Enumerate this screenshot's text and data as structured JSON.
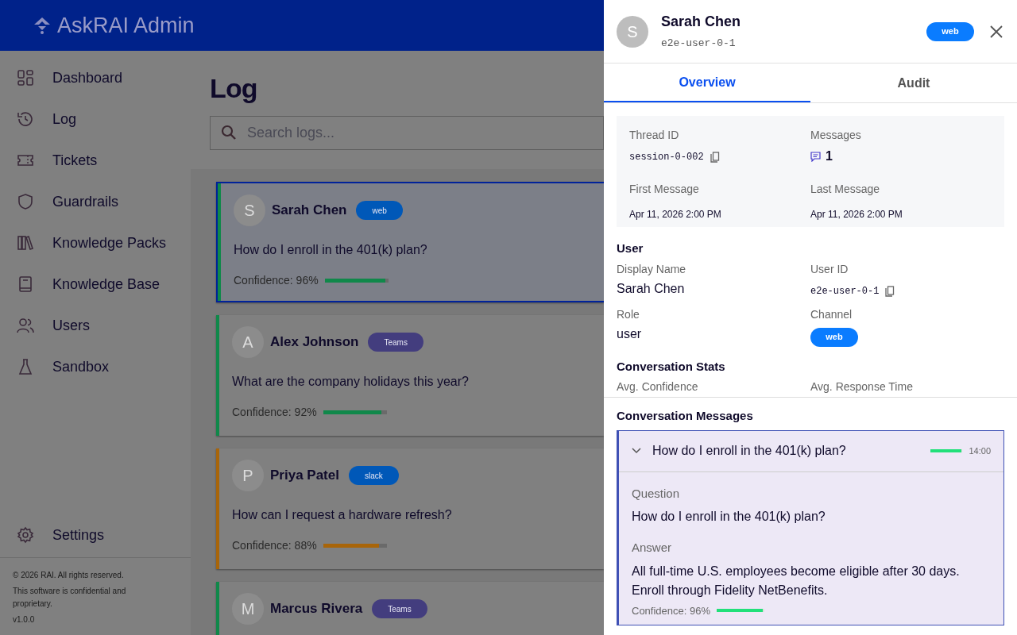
{
  "header": {
    "title": "AskRAI Admin"
  },
  "sidebar": {
    "items": [
      {
        "label": "Dashboard"
      },
      {
        "label": "Log"
      },
      {
        "label": "Tickets"
      },
      {
        "label": "Guardrails"
      },
      {
        "label": "Knowledge Packs"
      },
      {
        "label": "Knowledge Base"
      },
      {
        "label": "Users"
      },
      {
        "label": "Sandbox"
      }
    ],
    "settings": "Settings",
    "footer": [
      "© 2026 RAI. All rights reserved.",
      "This software is confidential and proprietary.",
      "v1.0.0"
    ]
  },
  "page": {
    "title": "Log",
    "search": {
      "placeholder": "Search logs..."
    }
  },
  "logs": [
    {
      "initial": "S",
      "name": "Sarah Chen",
      "channel": {
        "label": "web",
        "color": "#0058b8"
      },
      "question": "How do I enroll in the 401(k) plan?",
      "confidence": "Confidence: 96%",
      "level": 0.96,
      "color": "#10884a",
      "selected": true
    },
    {
      "initial": "A",
      "name": "Alex Johnson",
      "channel": {
        "label": "Teams",
        "color": "#433d7e"
      },
      "question": "What are the company holidays this year?",
      "confidence": "Confidence: 92%",
      "level": 0.92,
      "color": "#10884a",
      "selected": false
    },
    {
      "initial": "P",
      "name": "Priya Patel",
      "channel": {
        "label": "slack",
        "color": "#0058b8"
      },
      "question": "How can I request a hardware refresh?",
      "confidence": "Confidence: 88%",
      "level": 0.88,
      "color": "#a8650a",
      "selected": false
    },
    {
      "initial": "M",
      "name": "Marcus Rivera",
      "channel": {
        "label": "Teams",
        "color": "#433d7e"
      },
      "color": "#10884a",
      "selected": false
    }
  ],
  "panel": {
    "initial": "S",
    "name": "Sarah Chen",
    "user_id": "e2e-user-0-1",
    "channel": "web",
    "tabs": [
      {
        "label": "Overview",
        "selected": true
      },
      {
        "label": "Audit",
        "selected": false
      }
    ],
    "thread": [
      {
        "label": "Thread ID",
        "value": "session-0-002",
        "kind": "code"
      },
      {
        "label": "Messages",
        "value": "1",
        "kind": "count"
      },
      {
        "label": "First Message",
        "value": "Apr 11, 2026 2:00 PM",
        "kind": "date"
      },
      {
        "label": "Last Message",
        "value": "Apr 11, 2026 2:00 PM",
        "kind": "date"
      }
    ],
    "user_title": "User",
    "user": [
      {
        "label": "Display Name",
        "value": "Sarah Chen",
        "kind": "text"
      },
      {
        "label": "User ID",
        "value": "e2e-user-0-1",
        "kind": "code"
      },
      {
        "label": "Role",
        "value": "user",
        "kind": "text"
      },
      {
        "label": "Channel",
        "value": "web",
        "kind": "badge"
      }
    ],
    "stats_title": "Conversation Stats",
    "stats": [
      {
        "label": "Avg. Confidence"
      },
      {
        "label": "Avg. Response Time"
      }
    ],
    "messages_title": "Conversation Messages",
    "messages": [
      {
        "title": "How do I enroll in the 401(k) plan?",
        "time": "14:00",
        "level": 0.96,
        "expanded": true,
        "question_label": "Question",
        "question": "How do I enroll in the 401(k) plan?",
        "answer_label": "Answer",
        "answer": "All full-time U.S. employees become eligible after 30 days. Enroll through Fidelity NetBenefits.",
        "confidence": "Confidence: 96%"
      }
    ]
  }
}
